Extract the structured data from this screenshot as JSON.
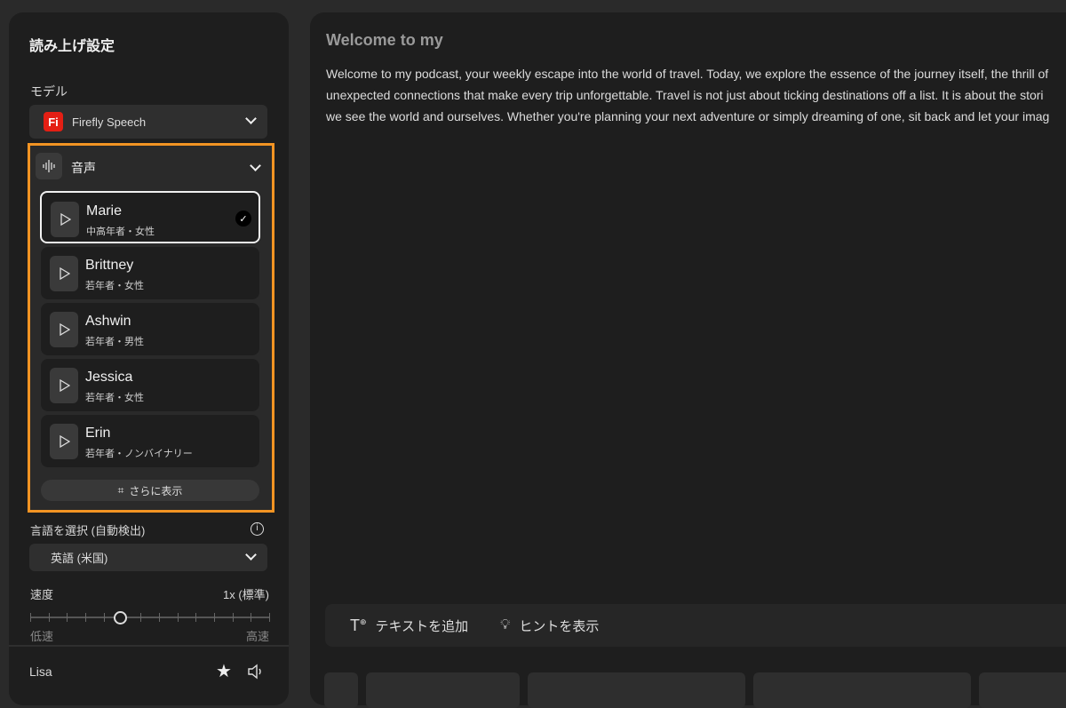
{
  "settings": {
    "title": "読み上げ設定",
    "model_label": "モデル",
    "model_value": "Firefly Speech",
    "model_logo": "Fi",
    "voice_section": "音声",
    "voices": [
      {
        "name": "Marie",
        "desc": "中高年者・女性",
        "selected": true
      },
      {
        "name": "Brittney",
        "desc": "若年者・女性"
      },
      {
        "name": "Ashwin",
        "desc": "若年者・男性"
      },
      {
        "name": "Jessica",
        "desc": "若年者・女性"
      },
      {
        "name": "Erin",
        "desc": "若年者・ノンバイナリー"
      }
    ],
    "show_more": "さらに表示",
    "language_label": "言語を選択 (自動検出)",
    "language_value": "英語 (米国)",
    "speed_label": "速度",
    "speed_value": "1x (標準)",
    "speed_fraction": 0.375,
    "speed_min": "低速",
    "speed_max": "高速",
    "footer_voice": "Lisa"
  },
  "editor": {
    "title": "Welcome to my",
    "lines": [
      "Welcome to my podcast, your weekly escape into the world of travel. Today, we explore the essence of the journey itself, the thrill of",
      "unexpected connections that make every trip unforgettable. Travel is not just about ticking destinations off a list. It is about the stori",
      "we see the world and ourselves. Whether you're planning your next adventure or simply dreaming of one, sit back and let your imag"
    ],
    "add_text": "テキストを追加",
    "show_hints": "ヒントを表示"
  },
  "colors": {
    "highlight": "#f29423",
    "brand": "#e41f14"
  }
}
